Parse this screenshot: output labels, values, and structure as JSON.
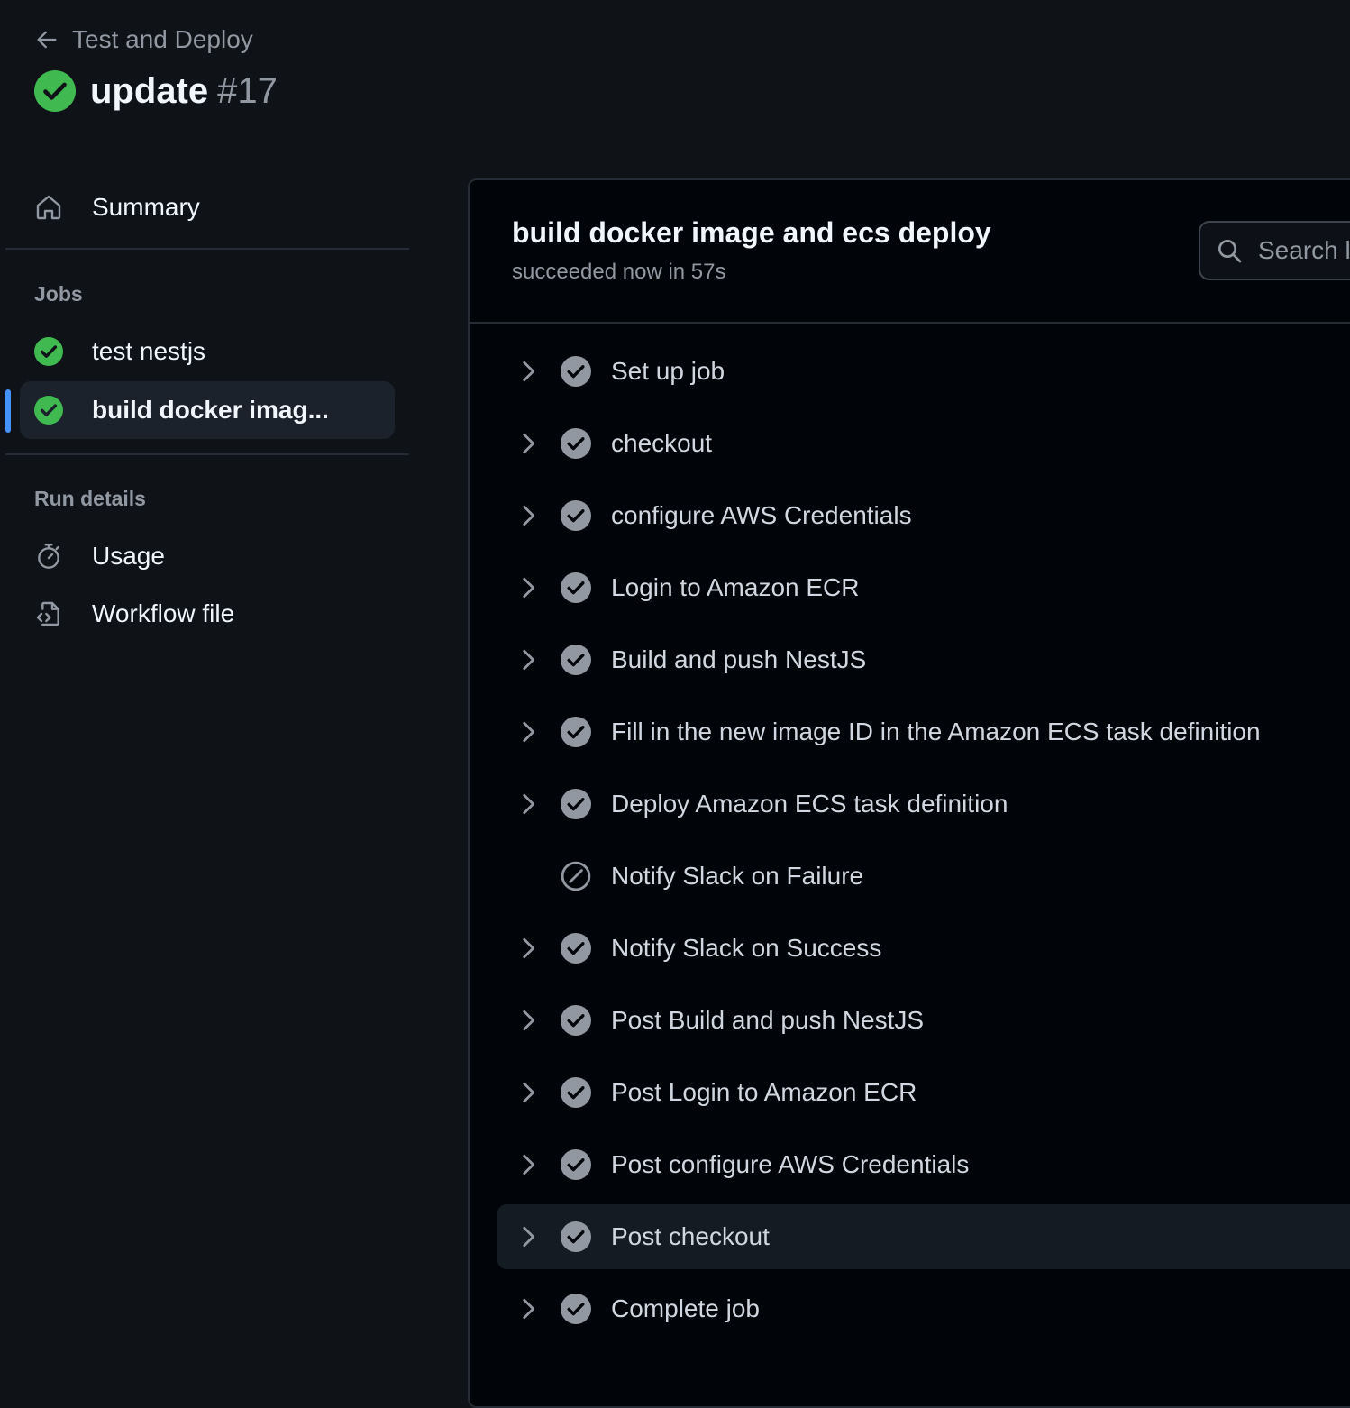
{
  "header": {
    "back_label": "Test and Deploy",
    "run_name": "update",
    "run_number": "#17"
  },
  "sidebar": {
    "summary_label": "Summary",
    "jobs_heading": "Jobs",
    "jobs": [
      {
        "label": "test nestjs",
        "status": "success"
      },
      {
        "label": "build docker imag...",
        "status": "success",
        "selected": true
      }
    ],
    "run_details_heading": "Run details",
    "usage_label": "Usage",
    "workflow_file_label": "Workflow file"
  },
  "job": {
    "title": "build docker image and ecs deploy",
    "subtitle": "succeeded now in 57s",
    "search_placeholder": "Search l"
  },
  "steps": [
    {
      "label": "Set up job",
      "status": "success",
      "expandable": true
    },
    {
      "label": "checkout",
      "status": "success",
      "expandable": true
    },
    {
      "label": "configure AWS Credentials",
      "status": "success",
      "expandable": true
    },
    {
      "label": "Login to Amazon ECR",
      "status": "success",
      "expandable": true
    },
    {
      "label": "Build and push NestJS",
      "status": "success",
      "expandable": true
    },
    {
      "label": "Fill in the new image ID in the Amazon ECS task definition",
      "status": "success",
      "expandable": true
    },
    {
      "label": "Deploy Amazon ECS task definition",
      "status": "success",
      "expandable": true
    },
    {
      "label": "Notify Slack on Failure",
      "status": "skipped",
      "expandable": false
    },
    {
      "label": "Notify Slack on Success",
      "status": "success",
      "expandable": true
    },
    {
      "label": "Post Build and push NestJS",
      "status": "success",
      "expandable": true
    },
    {
      "label": "Post Login to Amazon ECR",
      "status": "success",
      "expandable": true
    },
    {
      "label": "Post configure AWS Credentials",
      "status": "success",
      "expandable": true
    },
    {
      "label": "Post checkout",
      "status": "success",
      "expandable": true,
      "highlighted": true
    },
    {
      "label": "Complete job",
      "status": "success",
      "expandable": true
    }
  ],
  "colors": {
    "success": "#3fb950",
    "accent": "#4493f8",
    "step_icon": "#9198a1"
  },
  "icons": {
    "back": "arrow-left-icon",
    "run_status": "check-circle-fill-icon",
    "summary": "home-icon",
    "usage": "stopwatch-icon",
    "workflow": "file-code-icon",
    "search": "search-icon",
    "expand": "chevron-right-icon",
    "step_success": "check-circle-fill-icon",
    "step_skipped": "skip-icon"
  }
}
